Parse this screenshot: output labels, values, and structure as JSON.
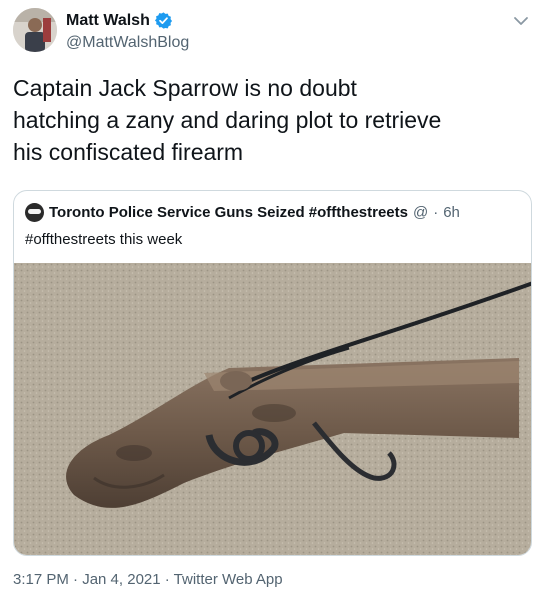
{
  "tweet": {
    "author_name": "Matt Walsh",
    "author_handle": "@MattWalshBlog",
    "text": "Captain Jack Sparrow is no doubt\nhatching a zany and daring plot to retrieve\nhis confiscated firearm",
    "timestamp": "3:17 PM · Jan 4, 2021 · Twitter Web App"
  },
  "quote": {
    "author_name": "Toronto Police Service Guns Seized #offthestreets",
    "verified_glyph": "@",
    "dot": "·",
    "time": "6h",
    "text": "#offthestreets this week"
  },
  "icons": {
    "verified": "verified-badge-icon",
    "menu": "chevron-down-icon"
  },
  "colors": {
    "verified_blue": "#1d9bf0",
    "secondary_text": "#536471",
    "border": "#cfd9de"
  }
}
